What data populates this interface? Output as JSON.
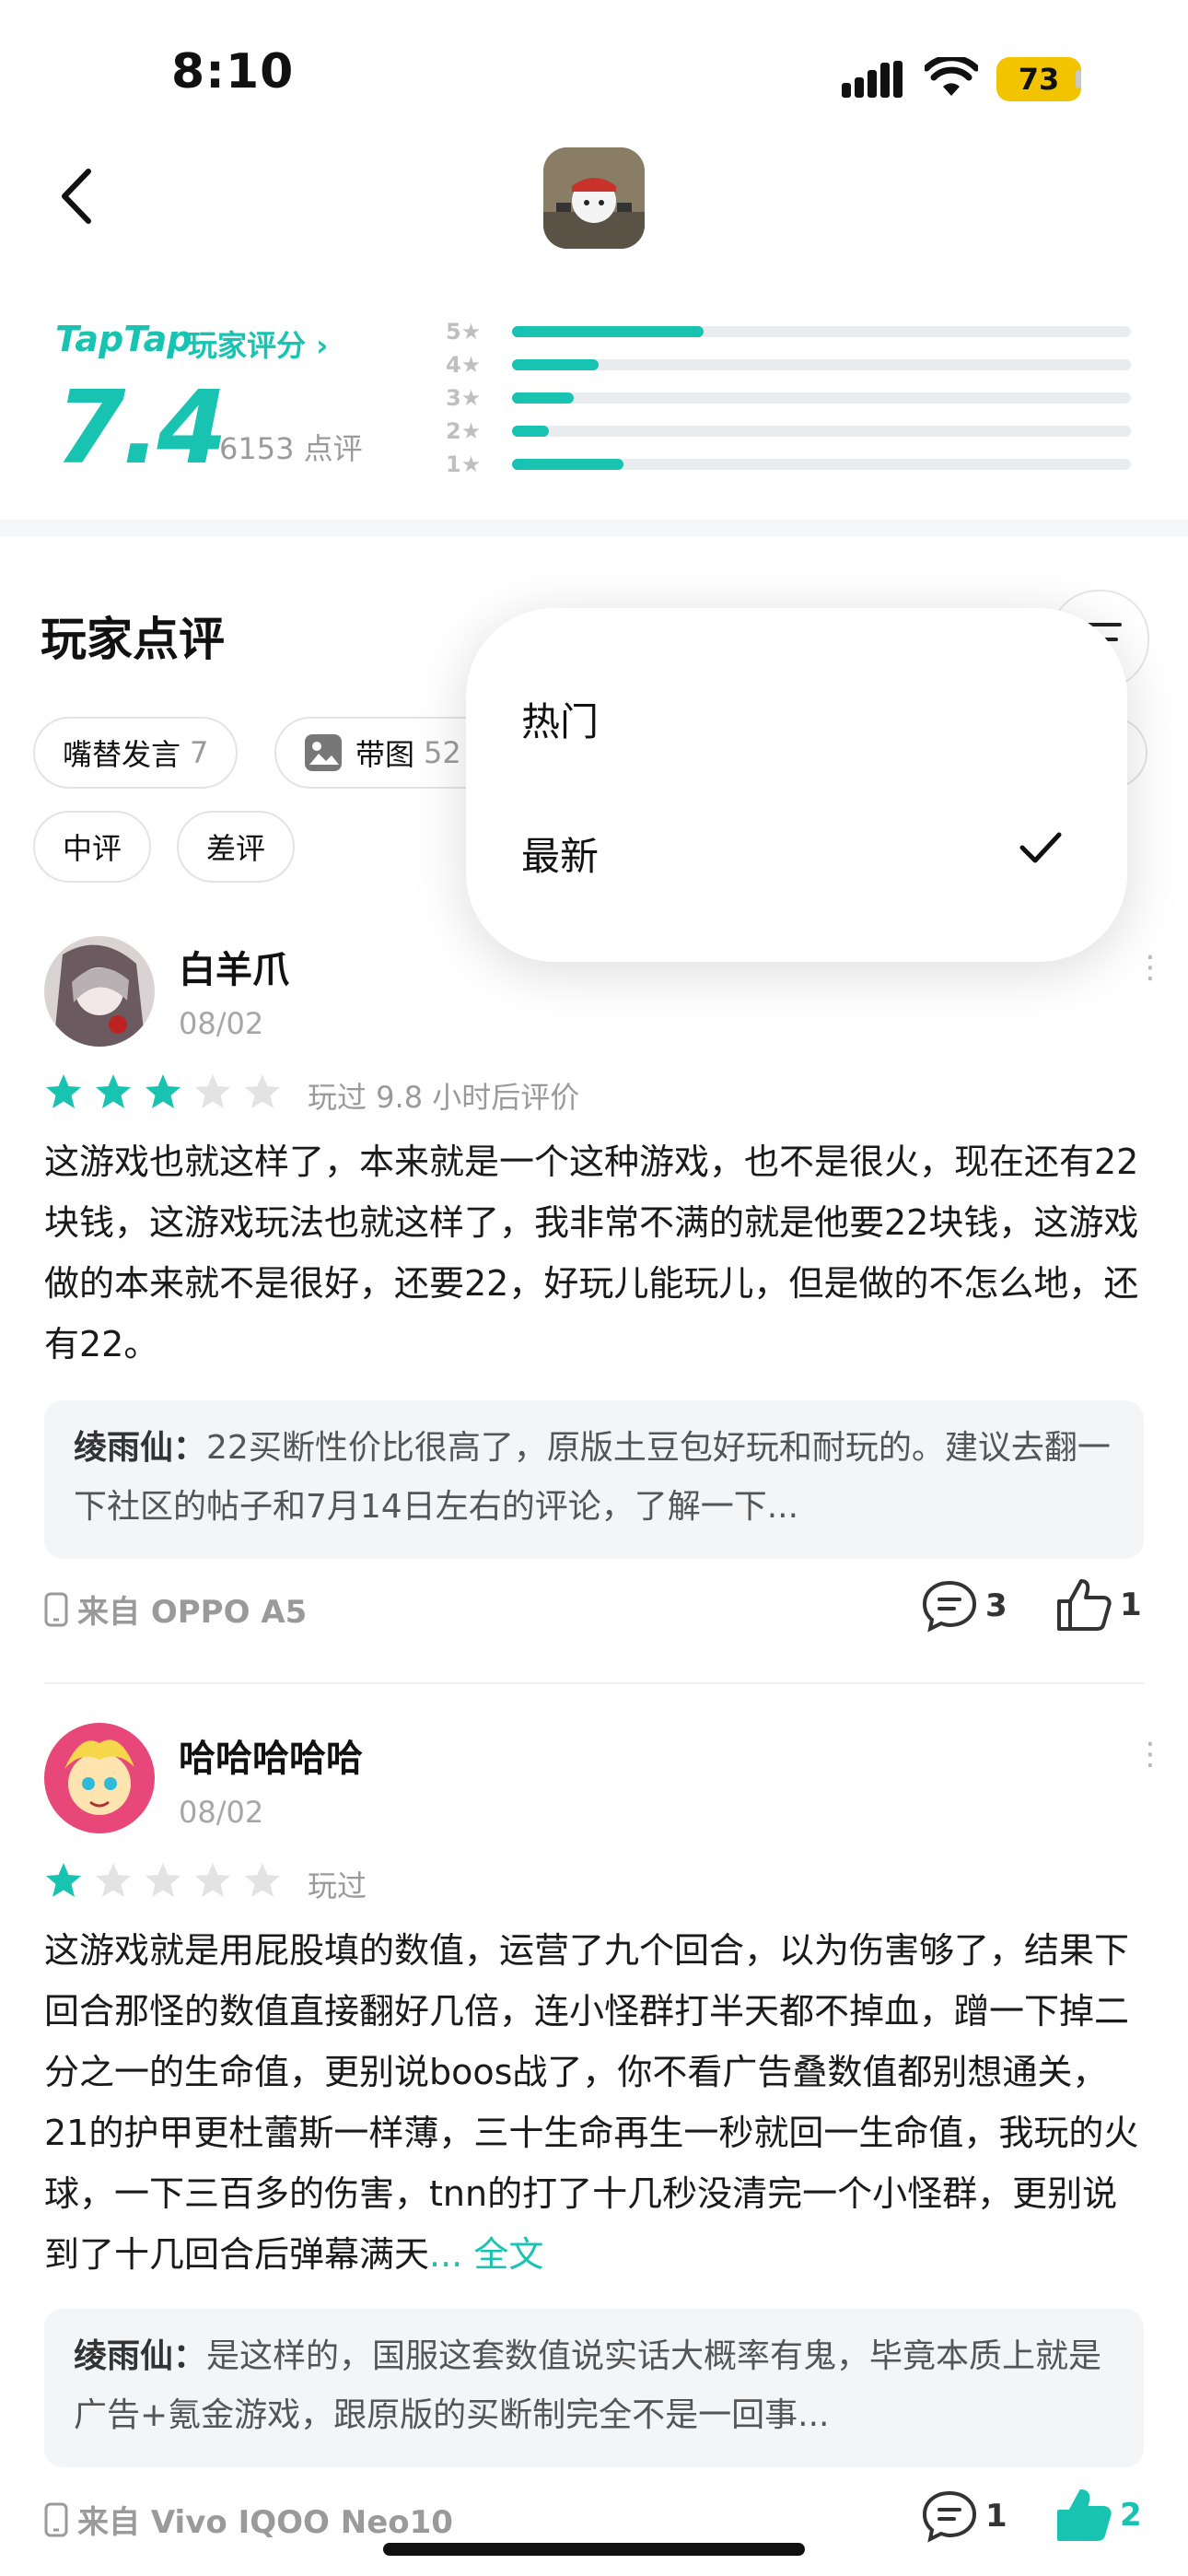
{
  "status_bar": {
    "time": "8:10",
    "battery": "73"
  },
  "rating": {
    "brand": "TapTap",
    "label": "玩家评分 ›",
    "score": "7.4",
    "count": "6153 点评",
    "distribution": [
      {
        "label": "5★",
        "fraction": 0.31
      },
      {
        "label": "4★",
        "fraction": 0.14
      },
      {
        "label": "3★",
        "fraction": 0.1
      },
      {
        "label": "2★",
        "fraction": 0.06
      },
      {
        "label": "1★",
        "fraction": 0.18
      }
    ]
  },
  "reviews_section": {
    "title": "玩家点评",
    "chips": [
      {
        "label": "嘴替发言",
        "count": "7"
      },
      {
        "label": "带图",
        "count": "52"
      },
      {
        "label": "中评",
        "count": ""
      },
      {
        "label": "差评",
        "count": ""
      }
    ]
  },
  "sort_menu": {
    "options": [
      "热门",
      "最新"
    ],
    "selected": "最新"
  },
  "reviews": [
    {
      "user": "白羊爪",
      "date": "08/02",
      "stars": 3,
      "playtime": "玩过 9.8 小时后评价",
      "text": "这游戏也就这样了，本来就是一个这种游戏，也不是很火，现在还有22块钱，这游戏玩法也就这样了，我非常不满的就是他要22块钱，这游戏做的本来就不是很好，还要22，好玩儿能玩儿，但是做的不怎么地，还有22。",
      "reply_user": "绫雨仙：",
      "reply_text": "22买断性价比很高了，原版土豆包好玩和耐玩的。建议去翻一下社区的帖子和7月14日左右的评论，了解一下...",
      "device": "来自 OPPO A5",
      "comments": "3",
      "likes": "1"
    },
    {
      "user": "哈哈哈哈哈",
      "date": "08/02",
      "stars": 1,
      "playtime": "玩过",
      "text": "这游戏就是用屁股填的数值，运营了九个回合，以为伤害够了，结果下回合那怪的数值直接翻好几倍，连小怪群打半天都不掉血，蹭一下掉二分之一的生命值，更别说boos战了，你不看广告叠数值都别想通关，21的护甲更杜蕾斯一样薄，三十生命再生一秒就回一生命值，我玩的火球，一下三百多的伤害，tnn的打了十几秒没清完一个小怪群，更别说到了十几回合后弹幕满天",
      "more": "... 全文",
      "reply_user": "绫雨仙：",
      "reply_text": "是这样的，国服这套数值说实话大概率有鬼，毕竟本质上就是广告+氪金游戏，跟原版的买断制完全不是一回事...",
      "device": "来自 Vivo IQOO Neo10",
      "comments": "1",
      "likes": "2"
    }
  ],
  "colors": {
    "accent": "#19c3b1",
    "battery": "#f2c400"
  },
  "icons": [
    "signal-icon",
    "wifi-icon",
    "back-arrow-icon",
    "filter-icon",
    "image-icon",
    "check-icon",
    "star-icon",
    "phone-icon",
    "comment-icon",
    "like-icon",
    "more-icon"
  ]
}
